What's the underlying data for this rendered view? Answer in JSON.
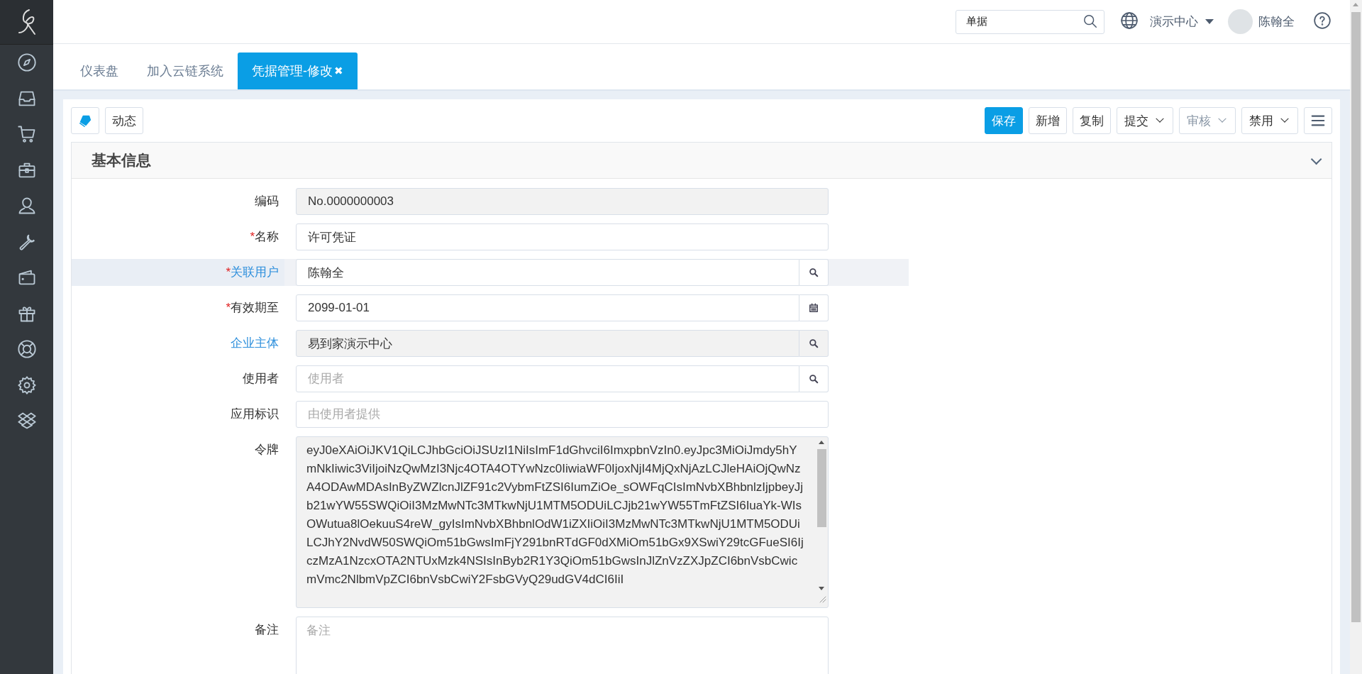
{
  "header": {
    "search": {
      "value": "单据"
    },
    "org": "演示中心",
    "user": "陈翰全"
  },
  "tabs": [
    {
      "label": "仪表盘",
      "selected": false,
      "closable": false
    },
    {
      "label": "加入云链系统",
      "selected": false,
      "closable": false
    },
    {
      "label": "凭据管理-修改",
      "selected": true,
      "closable": true,
      "close": "✖"
    }
  ],
  "toolbar": {
    "left": [
      {
        "kind": "icon"
      },
      {
        "kind": "text",
        "label": "动态"
      }
    ],
    "right": [
      {
        "label": "保存",
        "primary": true,
        "dropdown": false,
        "disabled": false
      },
      {
        "label": "新增",
        "primary": false,
        "dropdown": false,
        "disabled": false
      },
      {
        "label": "复制",
        "primary": false,
        "dropdown": false,
        "disabled": false
      },
      {
        "label": "提交",
        "primary": false,
        "dropdown": true,
        "disabled": false
      },
      {
        "label": "审核",
        "primary": false,
        "dropdown": true,
        "disabled": true
      },
      {
        "label": "禁用",
        "primary": false,
        "dropdown": true,
        "disabled": false
      }
    ]
  },
  "section": {
    "title": "基本信息",
    "expanded": true
  },
  "fields": [
    {
      "label": "编码",
      "kind": "text",
      "link": false,
      "readonly": true,
      "focused": false,
      "value": "No.0000000003"
    },
    {
      "label": "名称",
      "kind": "text",
      "mark": "*",
      "link": false,
      "readonly": false,
      "focused": false,
      "value": "许可凭证"
    },
    {
      "label": "关联用户",
      "kind": "lookup",
      "mark": "*",
      "link": true,
      "readonly": false,
      "focused": true,
      "value": "陈翰全"
    },
    {
      "label": "有效期至",
      "kind": "date",
      "mark": "*",
      "link": false,
      "readonly": false,
      "focused": false,
      "value": "2099-01-01"
    },
    {
      "label": "企业主体",
      "kind": "lookup",
      "link": true,
      "readonly": true,
      "focused": false,
      "value": "易到家演示中心"
    },
    {
      "label": "使用者",
      "kind": "lookup",
      "link": false,
      "readonly": false,
      "focused": false,
      "placeholder": "使用者"
    },
    {
      "label": "应用标识",
      "kind": "text",
      "link": false,
      "readonly": false,
      "focused": false,
      "placeholder": "由使用者提供"
    },
    {
      "label": "令牌",
      "kind": "textarea",
      "link": false,
      "readonly": true,
      "focused": false,
      "value": "eyJ0eXAiOiJKV1QiLCJhbGciOiJSUzI1NiIsImF1dGhvciI6ImxpbnVzIn0.eyJpc3MiOiJmdy5hYmNkIiwic3ViIjoiNzQwMzI3Njc4OTA4OTYwNzc0IiwiaWF0IjoxNjI4MjQxNjAzLCJleHAiOjQwNzA4ODAwMDAsInByZWZlcnJlZF91c2VybmFtZSI6IumZiOe_sOWFqCIsImNvbXBhbnlzIjpbeyJjb21wYW55SWQiOiI3MzMwNTc3MTkwNjU1MTM5ODUiLCJjb21wYW55TmFtZSI6IuaYk-WIsOWutua8lOekuuS4reW_gyIsImNvbXBhbnlOdW1iZXIiOiI3MzMwNTc3MTkwNjU1MTM5ODUiLCJhY2NvdW50SWQiOm51bGwsImFjY291bnRTdGF0dXMiOm51bGx9XSwiY29tcGFueSI6IjczMzA1NzcxOTA2NTUxMzk4NSIsInByb2R1Y3QiOm51bGwsInJlZnVzZXJpZCI6bnVsbCwicmVmc2NlbmVpZCI6bnVsbCwiY2FsbGVyQ29udGV4dCI6IiI"
    },
    {
      "label": "备注",
      "kind": "textarea",
      "link": false,
      "readonly": false,
      "focused": false,
      "placeholder": "备注"
    }
  ]
}
